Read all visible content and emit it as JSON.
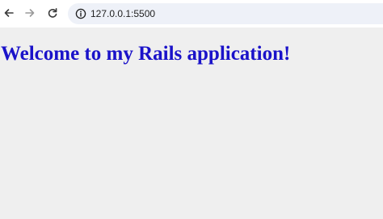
{
  "toolbar": {
    "back_icon": "arrow-left-icon",
    "forward_icon": "arrow-right-icon",
    "reload_icon": "reload-icon",
    "site_info_icon": "info-circle-icon"
  },
  "address_bar": {
    "url": "127.0.0.1:5500"
  },
  "page": {
    "heading": "Welcome to my Rails application!",
    "heading_color": "#1a12c9",
    "background_color": "#efefef"
  }
}
